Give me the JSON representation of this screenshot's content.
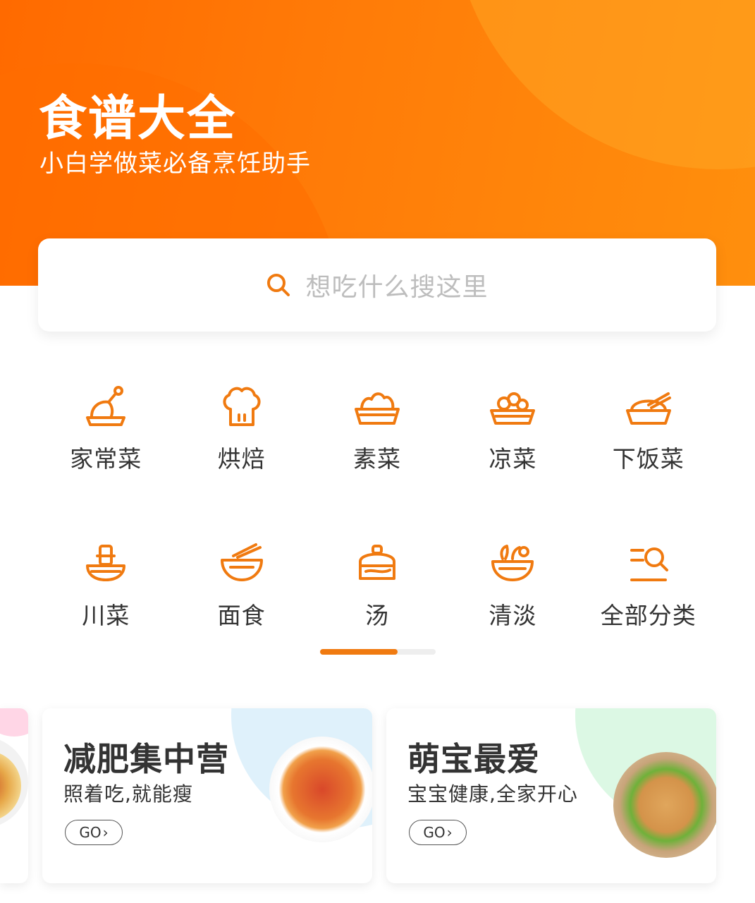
{
  "header": {
    "title": "食谱大全",
    "subtitle": "小白学做菜必备烹饪助手"
  },
  "search": {
    "placeholder": "想吃什么搜这里"
  },
  "categories": [
    {
      "label": "家常菜",
      "icon": "roast-chicken-icon"
    },
    {
      "label": "烘焙",
      "icon": "chef-hat-icon"
    },
    {
      "label": "素菜",
      "icon": "vegetable-dish-icon"
    },
    {
      "label": "凉菜",
      "icon": "cold-dish-icon"
    },
    {
      "label": "下饭菜",
      "icon": "covered-dish-icon"
    },
    {
      "label": "川菜",
      "icon": "hotpot-icon"
    },
    {
      "label": "面食",
      "icon": "noodle-bowl-icon"
    },
    {
      "label": "汤",
      "icon": "soup-pot-icon"
    },
    {
      "label": "清淡",
      "icon": "salad-bowl-icon"
    },
    {
      "label": "全部分类",
      "icon": "category-search-icon"
    }
  ],
  "pager": {
    "page": 1,
    "pages": 2
  },
  "promos": [
    {
      "title": "减肥集中营",
      "subtitle": "照着吃,就能瘦",
      "button": "GO",
      "image": "pasta-plate"
    },
    {
      "title": "萌宝最爱",
      "subtitle": "宝宝健康,全家开心",
      "button": "GO",
      "image": "burger-plate"
    }
  ],
  "colors": {
    "accent": "#f07a10",
    "header_start": "#ff6a00",
    "header_end": "#ff8f0d"
  }
}
